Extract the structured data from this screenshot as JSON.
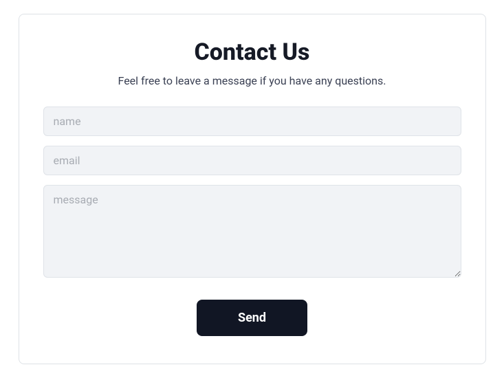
{
  "header": {
    "title": "Contact Us",
    "subtitle": "Feel free to leave a message if you have any questions."
  },
  "form": {
    "name_placeholder": "name",
    "name_value": "",
    "email_placeholder": "email",
    "email_value": "",
    "message_placeholder": "message",
    "message_value": "",
    "submit_label": "Send"
  }
}
